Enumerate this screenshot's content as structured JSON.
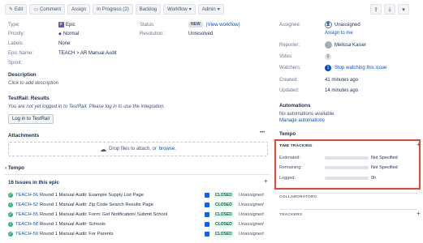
{
  "toolbar": {
    "edit": "Edit",
    "comment": "Comment",
    "assign": "Assign",
    "in_progress": "In Progress (2)",
    "backlog": "Backlog",
    "workflow": "Workflow",
    "admin": "Admin"
  },
  "details": {
    "type_label": "Type:",
    "type_value": "Epic",
    "priority_label": "Priority:",
    "priority_value": "Normal",
    "labels_label": "Labels:",
    "labels_value": "None",
    "epic_name_label": "Epic Name:",
    "epic_name_value": "TEACH > AR Manual Audit",
    "sprint_label": "Sprint:",
    "status_label": "Status:",
    "status_badge": "NEW",
    "status_link": "(View workflow)",
    "resolution_label": "Resolution:",
    "resolution_value": "Unresolved"
  },
  "description": {
    "heading": "Description",
    "placeholder": "Click to add description"
  },
  "testrail": {
    "heading": "TestRail: Results",
    "message": "You are not yet logged in to TestRail. Please log in to use the integration.",
    "login_button": "Log in to TestRail"
  },
  "attachments": {
    "heading": "Attachments",
    "more": "•••",
    "drop_text": "Drop files to attach, or",
    "browse": "browse."
  },
  "tempo_left": "Tempo",
  "epic_issues": {
    "heading": "16 Issues in this epic",
    "add": "+",
    "items": [
      {
        "key": "TEACH-56",
        "summary": "Round 1 Manual Audit: Example Supply List Page",
        "status": "CLOSED",
        "assignee": "Unassigned"
      },
      {
        "key": "TEACH-52",
        "summary": "Round 1 Manual Audit: Zip Code Search Results Page",
        "status": "CLOSED",
        "assignee": "Unassigned"
      },
      {
        "key": "TEACH-55",
        "summary": "Round 1 Manual Audit: Form: Get Notification/ Submit School",
        "status": "CLOSED",
        "assignee": "Unassigned"
      },
      {
        "key": "TEACH-58",
        "summary": "Round 1 Manual Audit: Schools",
        "status": "CLOSED",
        "assignee": "Unassigned"
      },
      {
        "key": "TEACH-59",
        "summary": "Round 1 Manual Audit: For Parents",
        "status": "CLOSED",
        "assignee": "Unassigned"
      }
    ]
  },
  "people": {
    "assignee_label": "Assignee:",
    "assignee_value": "Unassigned",
    "assign_to_me": "Assign to me",
    "reporter_label": "Reporter:",
    "reporter_value": "Melissa Kaiser",
    "votes_label": "Votes:",
    "votes_value": "0",
    "watchers_label": "Watchers:",
    "watchers_count": "1",
    "watchers_link": "Stop watching this issue"
  },
  "dates": {
    "created_label": "Created:",
    "created_value": "41 minutes ago",
    "updated_label": "Updated:",
    "updated_value": "14 minutes ago"
  },
  "automations": {
    "heading": "Automations",
    "message": "No automations available.",
    "manage": "Manage automations"
  },
  "tempo_right": "Tempo",
  "time_tracking": {
    "title": "TIME TRACKING",
    "estimated_label": "Estimated:",
    "estimated_value": "Not Specified",
    "estimated_fill": 0,
    "remaining_label": "Remaining:",
    "remaining_value": "Not Specified",
    "remaining_fill": 0,
    "logged_label": "Logged:",
    "logged_value": "0h",
    "logged_fill": 0
  },
  "collaborators": "COLLABORATORS",
  "trackers": "TRACKERS",
  "colors": {
    "accent": "#0052cc",
    "highlight": "#e34935",
    "epic": "#6554c0",
    "closed": "#006644"
  }
}
